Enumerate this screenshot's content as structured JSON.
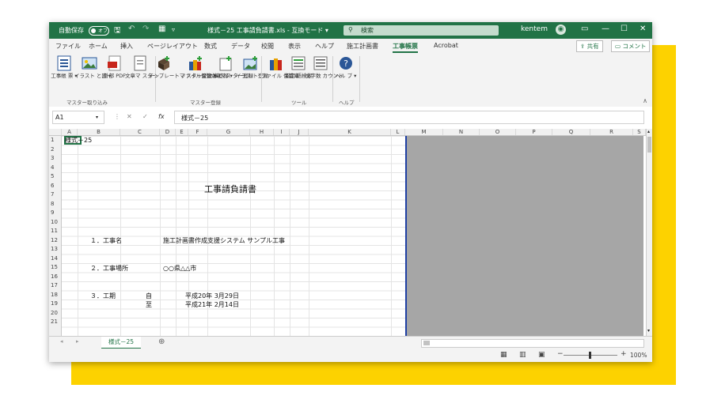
{
  "title_bar": {
    "autosave_label": "自動保存",
    "autosave_state": "オフ",
    "document_title": "様式－25 工事請負請書.xls - 互換モード ▾",
    "search_placeholder": "検索",
    "user_name": "kentem",
    "accent_color": "#217346"
  },
  "menu_tabs": [
    "ファイル",
    "ホーム",
    "挿入",
    "ページレイアウト",
    "数式",
    "データ",
    "校閲",
    "表示",
    "ヘルプ",
    "施工計画書",
    "工事帳票",
    "Acrobat"
  ],
  "active_tab": "工事帳票",
  "share_label": "共有",
  "comment_label": "コメント",
  "ribbon": {
    "buttons": [
      {
        "label": "工事帳 票 ▾"
      },
      {
        "label": "イラスト と図 ▾"
      },
      {
        "label": "外部 PDF"
      },
      {
        "label": "文章マ スター"
      },
      {
        "label": "テンプレートマ スター登録 ▾"
      },
      {
        "label": "ファイル保管 庫登録 ▾"
      },
      {
        "label": "文章マス ター登録"
      },
      {
        "label": "イラス ト登録"
      },
      {
        "label": "ファイル 保管庫"
      },
      {
        "label": "指定 語検索"
      },
      {
        "label": "文字数 カウント"
      },
      {
        "label": "ヘル プ ▾"
      }
    ],
    "groups": [
      "マスター取り込み",
      "マスター登録",
      "ツール",
      "ヘルプ"
    ]
  },
  "formula_bar": {
    "name_box": "A1",
    "fx": "fx",
    "formula": "様式－25"
  },
  "columns": [
    "A",
    "B",
    "C",
    "D",
    "E",
    "F",
    "G",
    "H",
    "I",
    "J",
    "K",
    "L",
    "M",
    "N",
    "O",
    "P",
    "Q",
    "R",
    "S"
  ],
  "rows": [
    "1",
    "2",
    "3",
    "4",
    "5",
    "6",
    "7",
    "8",
    "9",
    "10",
    "11",
    "12",
    "13",
    "14",
    "15",
    "16",
    "17",
    "18",
    "19",
    "20",
    "21"
  ],
  "cells": {
    "a1": "様式－25",
    "title": "工事請負請書",
    "item1_label": "１．工事名",
    "item1_value": "施工計画書作成支援システム サンプル工事",
    "item2_label": "２．工事場所",
    "item2_value": "○○県△△市",
    "item3_label": "３．工期",
    "from_label": "自",
    "from_date": "平成20年 3月29日",
    "to_label": "至",
    "to_date": "平成21年 2月14日"
  },
  "sheet_tab": "様式－25",
  "status": {
    "zoom": "100%"
  }
}
